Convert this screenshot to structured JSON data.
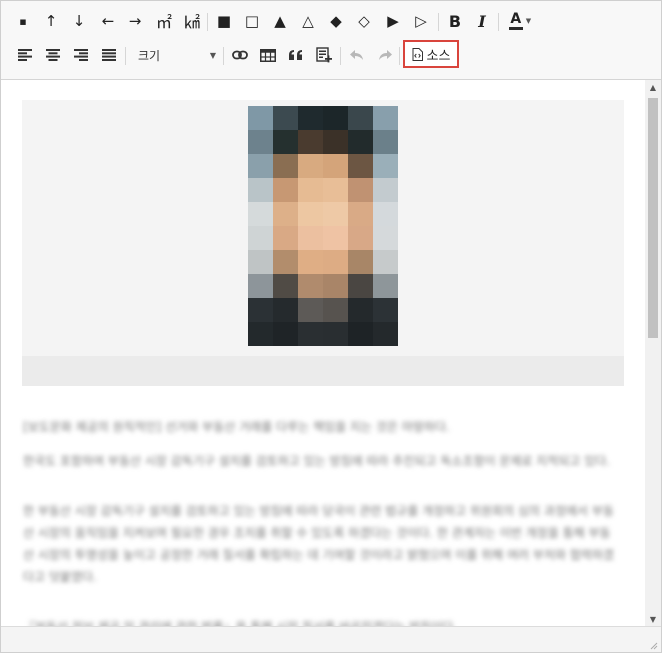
{
  "toolbar": {
    "row1": {
      "special_chars": [
        "▪",
        "↑",
        "↓",
        "←",
        "→",
        "㎡",
        "㎢",
        "■",
        "□",
        "▲",
        "△",
        "◆",
        "◇",
        "▶",
        "▷"
      ],
      "bold_label": "B",
      "italic_label": "I",
      "font_color_label": "A",
      "font_color_swatch": "#2b2b2b"
    },
    "row2": {
      "size_select_value": "크기",
      "source_button_label": "소스"
    },
    "highlight_color": "#d9443c"
  },
  "editor": {
    "background": "#ffffff",
    "image_block_background": "#f4f4f4",
    "paragraphs": [
      "[보도문화 제공의 원칙적인] 선거와 부동산 거래를 다루는 책임을 지는 것은 마땅하다.",
      "한국도 포함하여 부동산 시장 감독기구 설치를 검토하고 있는 방침에 따라 추진되고 독소조항이 문제로 지적되고 있다.",
      "한 부동산 시장 감독기구 설치를 검토하고 있는 방침에 따라 당국이 관련 법규를 개정하고 위원회의 심의 과정에서 부동산 시장의 움직임을 지켜보며 필요한 경우 조치를 취할 수 있도록 하겠다는 것이다. 한 관계자는 이번 개정을 통해 부동산 시장의 투명성을 높이고 공정한 거래 질서를 확립하는 데 기여할 것이라고 밝혔으며 이를 위해 여러 부처와 협력하겠다고 덧붙였다.",
      "『부동산 정보 제공 및 관리에 관한 법률』을 통해 시장 질서를 바로잡겠다는 방침이다."
    ]
  }
}
